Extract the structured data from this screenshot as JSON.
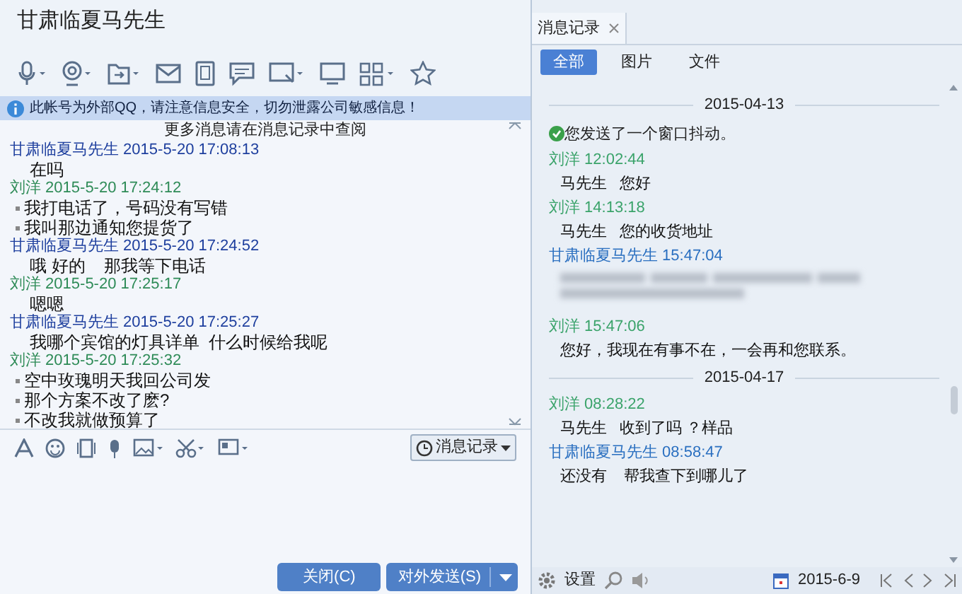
{
  "window": {
    "title": "甘肃临夏马先生"
  },
  "notice": "此帐号为外部QQ，请注意信息安全，切勿泄露公司敏感信息！",
  "chat": {
    "more_hint": "更多消息请在消息记录中查阅",
    "messages": [
      {
        "kind": "plain",
        "sender": "甘肃临夏马先生",
        "time": "2015-5-20 17:08:13",
        "color": "#1e3f9e",
        "lines": [
          "在吗"
        ]
      },
      {
        "kind": "bulleted",
        "sender": "刘洋",
        "time": "2015-5-20 17:24:12",
        "color": "#2e8b57",
        "lines": [
          "我打电话了，号码没有写错",
          "我叫那边通知您提货了"
        ]
      },
      {
        "kind": "plain",
        "sender": "甘肃临夏马先生",
        "time": "2015-5-20 17:24:52",
        "color": "#1e3f9e",
        "lines": [
          "哦 好的    那我等下电话"
        ]
      },
      {
        "kind": "plain",
        "sender": "刘洋",
        "time": "2015-5-20 17:25:17",
        "color": "#2e8b57",
        "lines": [
          "嗯嗯"
        ]
      },
      {
        "kind": "plain",
        "sender": "甘肃临夏马先生",
        "time": "2015-5-20 17:25:27",
        "color": "#1e3f9e",
        "lines": [
          "我哪个宾馆的灯具详单  什么时候给我呢"
        ]
      },
      {
        "kind": "bulleted",
        "sender": "刘洋",
        "time": "2015-5-20 17:25:32",
        "color": "#2e8b57",
        "lines": [
          "空中玫瑰明天我回公司发",
          "那个方案不改了麽?",
          "不改我就做预算了"
        ]
      }
    ]
  },
  "history_button": "消息记录",
  "buttons": [
    {
      "label": "关闭(C)"
    },
    {
      "label": "对外发送(S)"
    }
  ],
  "history": {
    "tab": "消息记录",
    "filters": [
      {
        "label": "全部",
        "selected": true
      },
      {
        "label": "图片",
        "selected": false
      },
      {
        "label": "文件",
        "selected": false
      }
    ],
    "items": [
      {
        "kind": "date",
        "text": "2015-04-13"
      },
      {
        "kind": "system",
        "text": "您发送了一个窗口抖动。"
      },
      {
        "kind": "message",
        "sender": "刘洋",
        "time": "12:02:44",
        "color": "#3aa36a",
        "text": "马先生   您好"
      },
      {
        "kind": "message",
        "sender": "刘洋",
        "time": "14:13:18",
        "color": "#3aa36a",
        "text": "马先生   您的收货地址"
      },
      {
        "kind": "blurred",
        "sender": "甘肃临夏马先生",
        "time": "15:47:04",
        "color": "#2a6fc0"
      },
      {
        "kind": "message",
        "sender": "刘洋",
        "time": "15:47:06",
        "color": "#3aa36a",
        "text": "您好，我现在有事不在，一会再和您联系。"
      },
      {
        "kind": "date",
        "text": "2015-04-17"
      },
      {
        "kind": "message",
        "sender": "刘洋",
        "time": "08:28:22",
        "color": "#3aa36a",
        "text": "马先生   收到了吗 ？样品"
      },
      {
        "kind": "message",
        "sender": "甘肃临夏马先生",
        "time": "08:58:47",
        "color": "#2a6fc0",
        "text": "还没有    帮我查下到哪儿了"
      }
    ],
    "settings": "设置",
    "date": "2015-6-9"
  }
}
